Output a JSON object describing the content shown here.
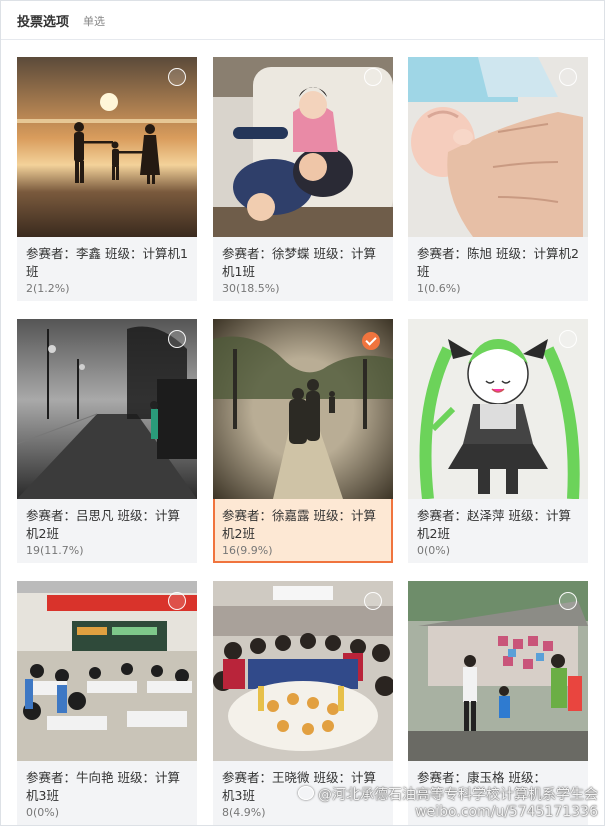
{
  "header": {
    "title": "投票选项",
    "subtitle": "单选"
  },
  "options": [
    {
      "name": "李鑫",
      "label": "参赛者：李鑫 班级：计算机1班",
      "votes": "2(1.2%)",
      "selected": false,
      "photo": "sunset-beach-family"
    },
    {
      "name": "徐梦蝶",
      "label": "参赛者：徐梦蝶 班级：计算机1班",
      "votes": "30(18.5%)",
      "selected": false,
      "photo": "kids-playing-on-sofa"
    },
    {
      "name": "陈旭",
      "label": "参赛者：陈旭 班级：计算机2班",
      "votes": "1(0.6%)",
      "selected": false,
      "photo": "baby-hand-holding-finger"
    },
    {
      "name": "吕思凡",
      "label": "参赛者：吕思凡 班级：计算机2班",
      "votes": "19(11.7%)",
      "selected": false,
      "photo": "foggy-street-night"
    },
    {
      "name": "徐嘉露",
      "label": "参赛者：徐嘉露 班级：计算机2班",
      "votes": "16(9.9%)",
      "selected": true,
      "photo": "elderly-couple-walking-park"
    },
    {
      "name": "赵泽萍",
      "label": "参赛者：赵泽萍 班级：计算机2班",
      "votes": "0(0%)",
      "selected": false,
      "photo": "anime-drawing-green-hair"
    },
    {
      "name": "牛向艳",
      "label": "参赛者：牛向艳 班级：计算机3班",
      "votes": "0(0%)",
      "selected": false,
      "photo": "classroom-students"
    },
    {
      "name": "王晓微",
      "label": "参赛者：王晓微 班级：计算机3班",
      "votes": "8(4.9%)",
      "selected": false,
      "photo": "group-dinner-party"
    },
    {
      "name": "康玉格",
      "label": "参赛者：康玉格 班级：",
      "votes": "",
      "selected": false,
      "photo": "outdoor-market-stalls"
    }
  ],
  "watermark": {
    "line1": "@河北承德石油高等专科学校计算机系学生会",
    "line2": "weibo.com/u/5745171336"
  },
  "colors": {
    "accent": "#f0743e",
    "selected_bg": "#fde8d4",
    "card_bg": "#f3f4f6"
  }
}
